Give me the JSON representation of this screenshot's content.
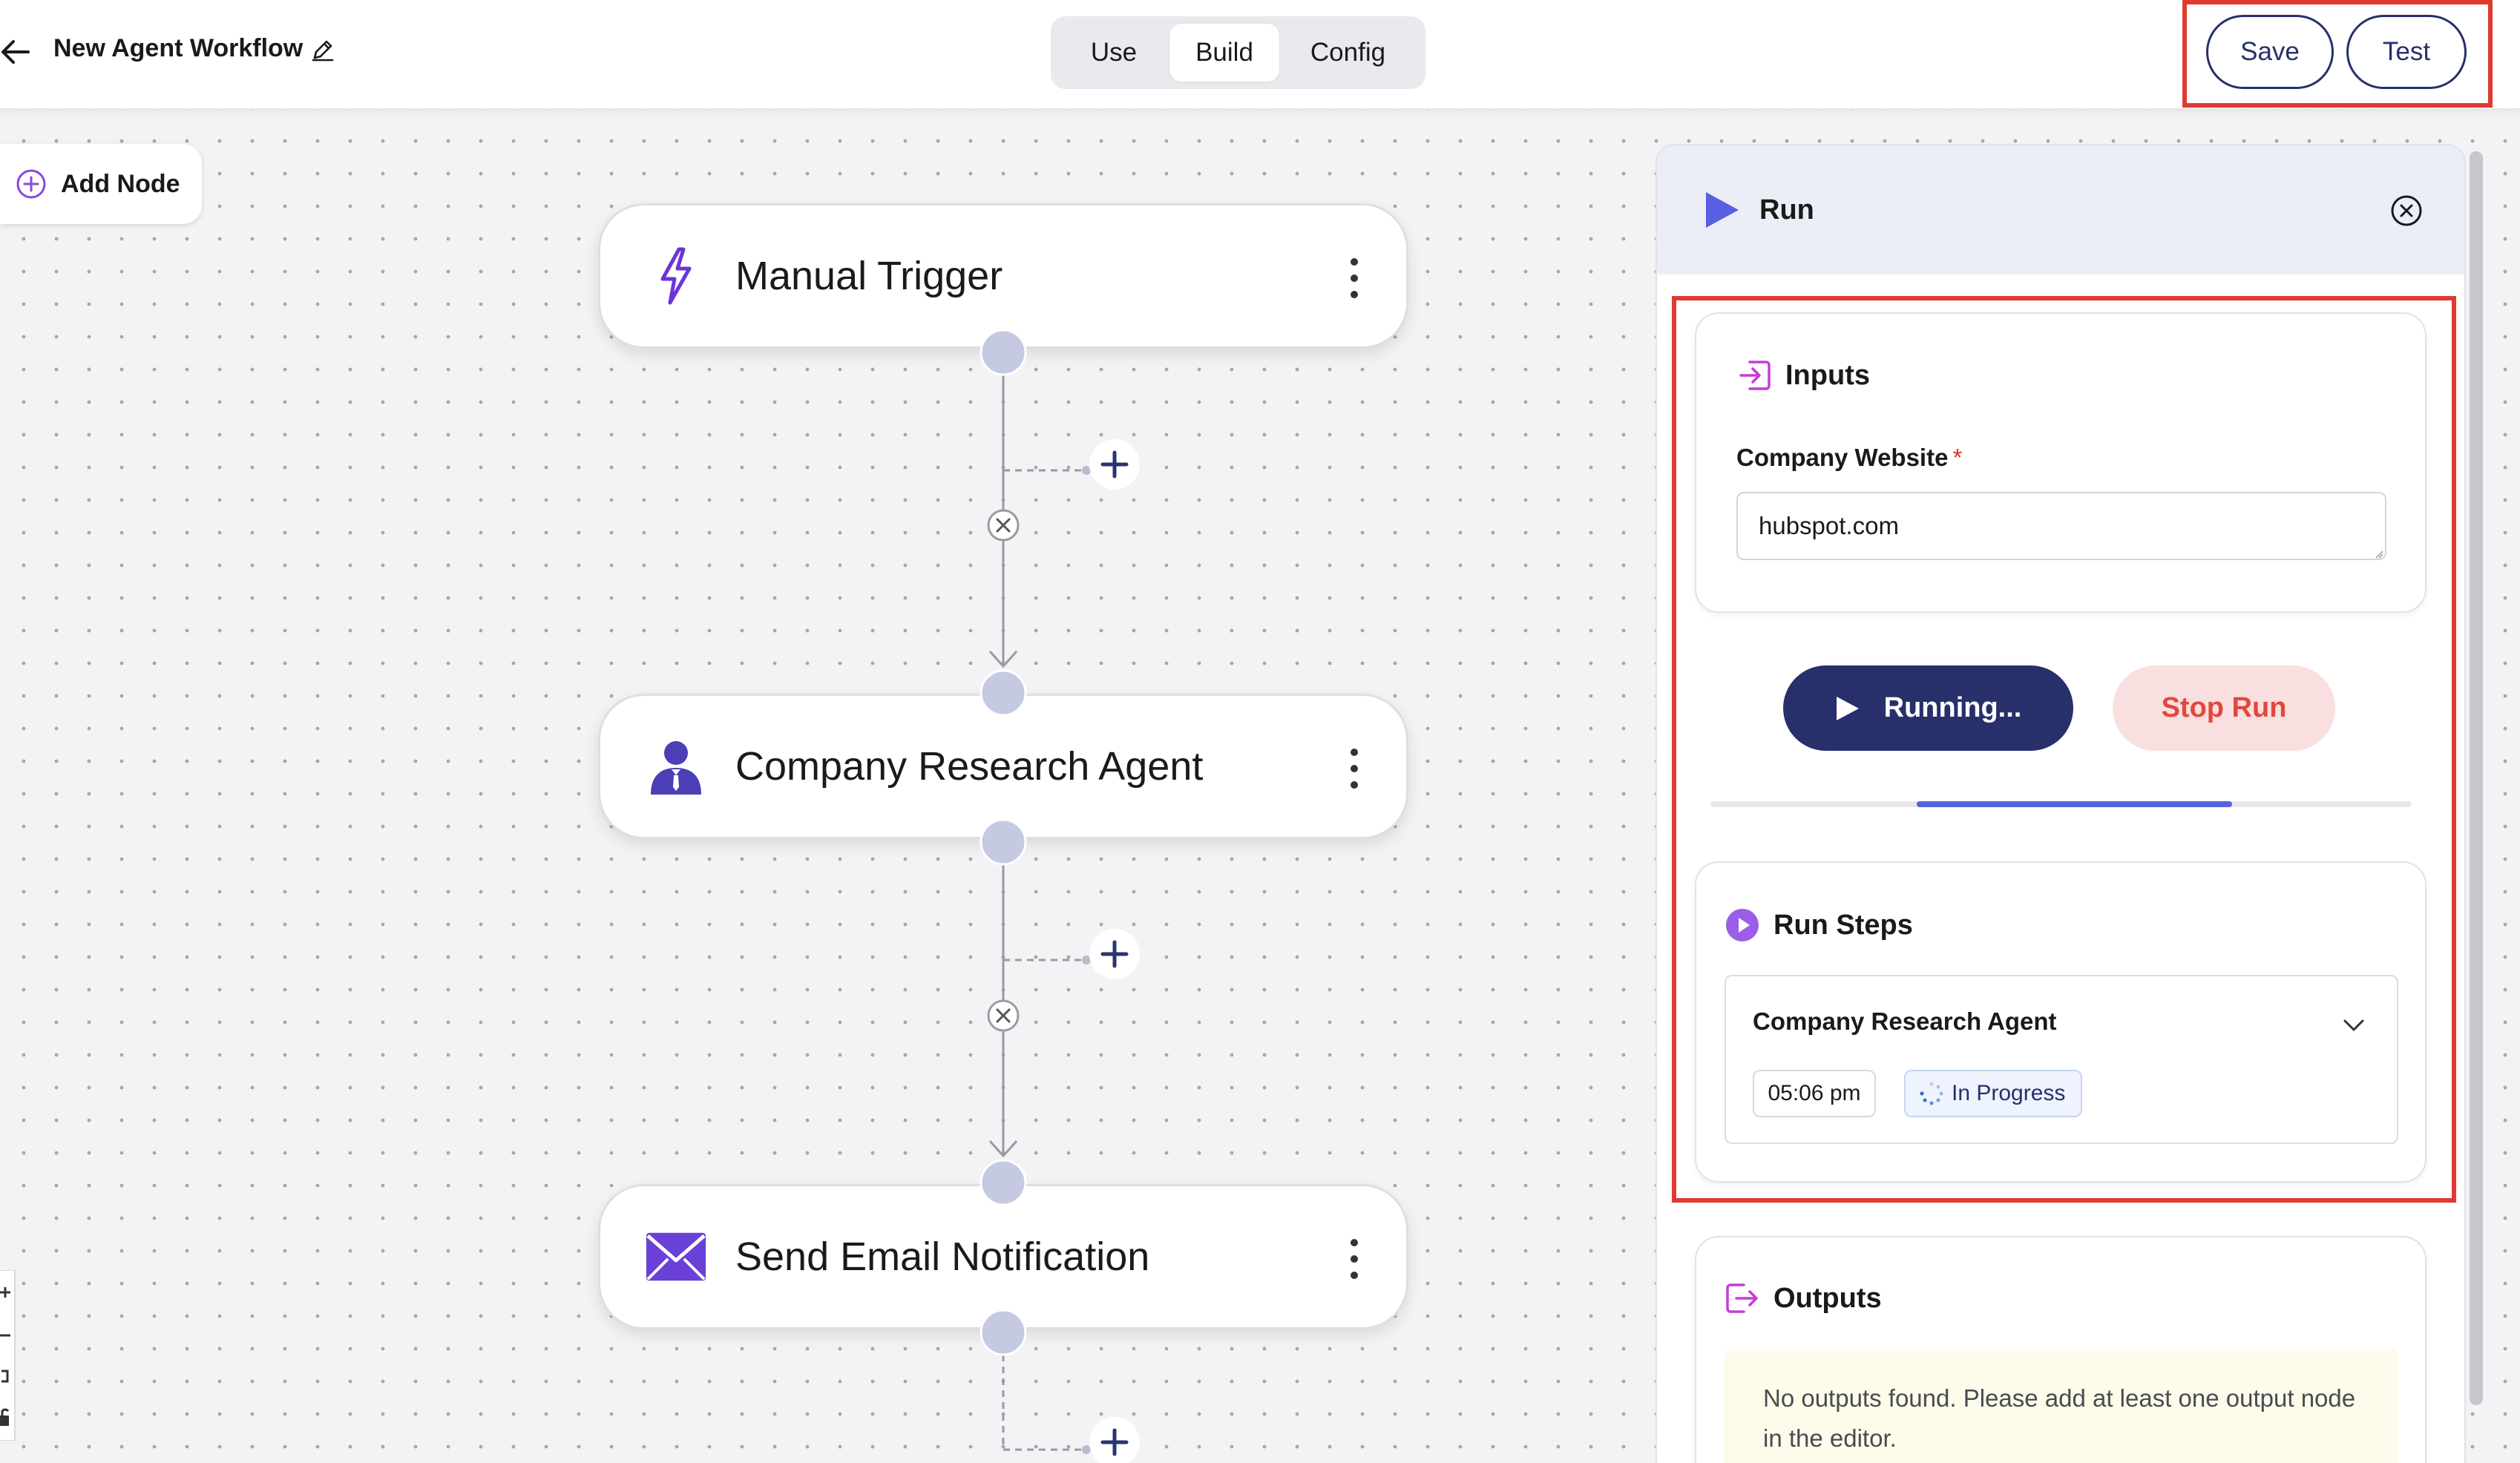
{
  "header": {
    "title": "New Agent Workflow",
    "tabs": [
      {
        "label": "Use",
        "active": false
      },
      {
        "label": "Build",
        "active": true
      },
      {
        "label": "Config",
        "active": false
      }
    ],
    "save_label": "Save",
    "test_label": "Test"
  },
  "canvas": {
    "add_node_label": "Add Node",
    "nodes": [
      {
        "title": "Manual Trigger",
        "icon": "lightning-bolt-icon"
      },
      {
        "title": "Company Research Agent",
        "icon": "agent-person-icon"
      },
      {
        "title": "Send Email Notification",
        "icon": "envelope-icon"
      }
    ]
  },
  "run_panel": {
    "title": "Run",
    "inputs": {
      "title": "Inputs",
      "field_label": "Company Website",
      "required_mark": "*",
      "field_value": "hubspot.com"
    },
    "running_label": "Running...",
    "stop_label": "Stop Run",
    "progress": 0.45,
    "run_steps": {
      "title": "Run Steps",
      "steps": [
        {
          "name": "Company Research Agent",
          "time": "05:06 pm",
          "status": "In Progress"
        }
      ]
    },
    "outputs": {
      "title": "Outputs",
      "empty_message": "No outputs found. Please add at least one output node in the editor."
    }
  },
  "colors": {
    "accent": "#27306b",
    "highlight": "#e03a2f",
    "node_icon": "#6a35d8",
    "progress": "#5566dd",
    "stop": "#e0483f"
  }
}
